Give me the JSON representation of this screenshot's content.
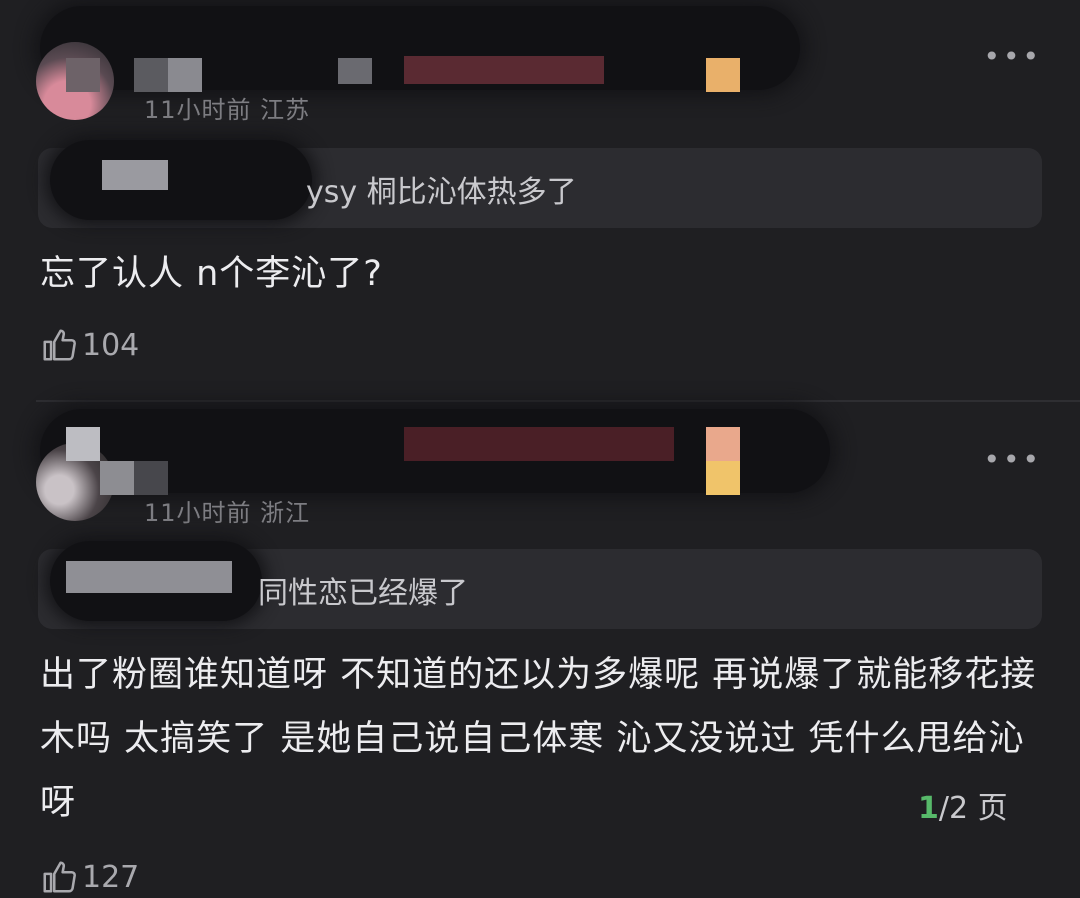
{
  "comments": [
    {
      "meta": "11小时前 江苏",
      "quote": "ysy 桐比沁体热多了",
      "body": "忘了认人 n个李沁了?",
      "likes": "104",
      "more": "•••"
    },
    {
      "meta": "11小时前 浙江",
      "quote": "同性恋已经爆了",
      "body": "出了粉圈谁知道呀 不知道的还以为多爆呢 再说爆了就能移花接木吗 太搞笑了 是她自己说自己体寒 沁又没说过 凭什么甩给沁呀",
      "likes": "127",
      "more": "•••"
    }
  ],
  "pager": {
    "current": "1",
    "rest": "/2 页"
  },
  "colors": {
    "background": "#1f1f22",
    "quote_bg": "#2c2c30",
    "pager_accent": "#57b96a"
  }
}
